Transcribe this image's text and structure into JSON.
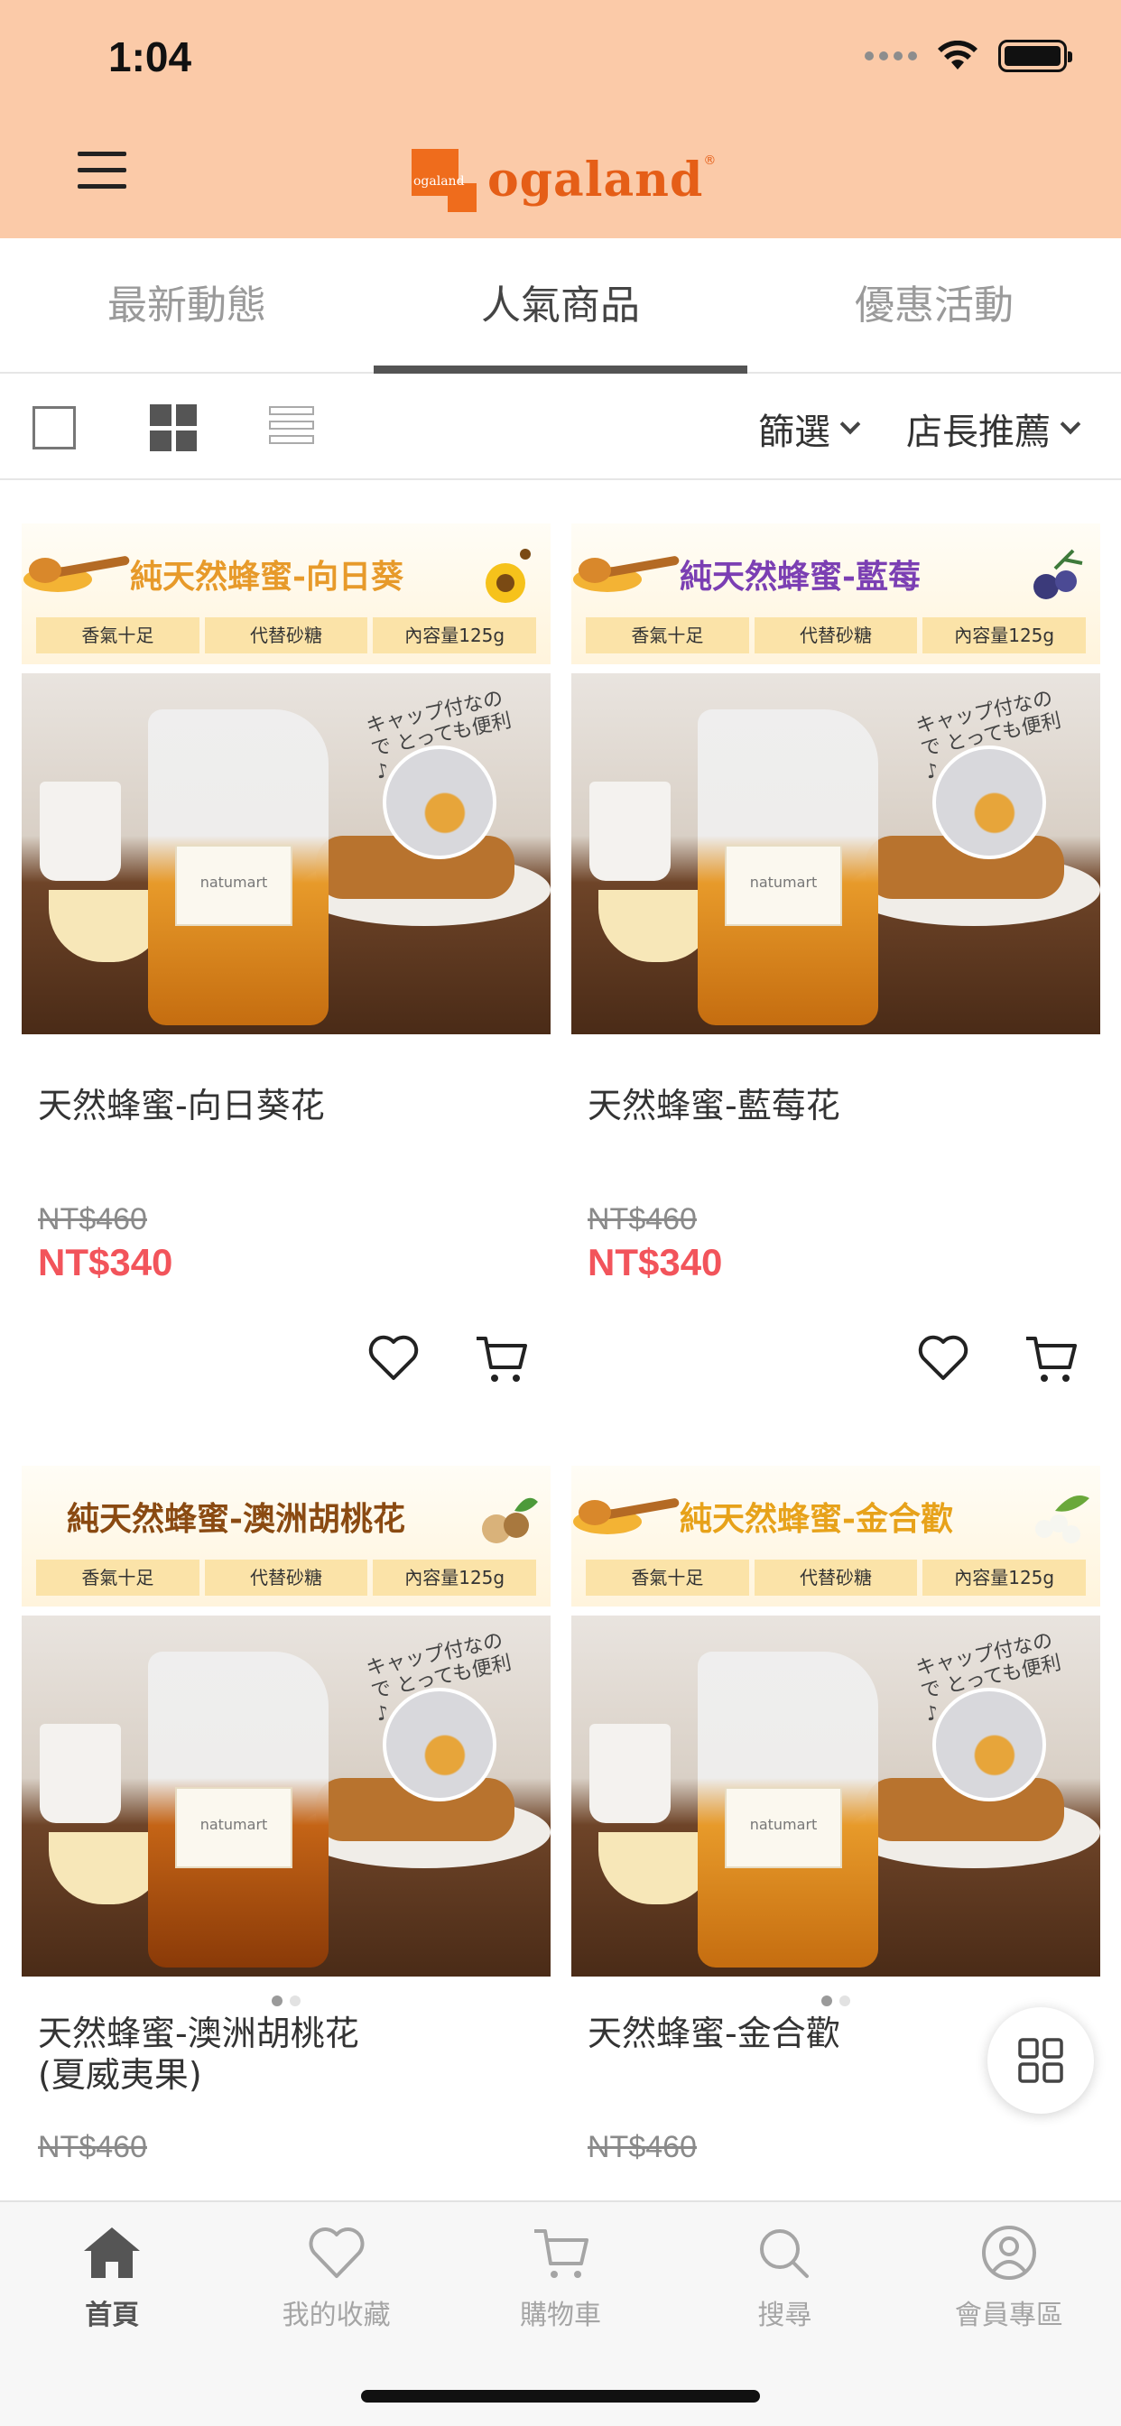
{
  "status_bar": {
    "time": "1:04"
  },
  "header": {
    "brand": "ogaland",
    "brand_mark": "ogaland"
  },
  "tabs": [
    {
      "label": "最新動態",
      "active": false
    },
    {
      "label": "人氣商品",
      "active": true
    },
    {
      "label": "優惠活動",
      "active": false
    }
  ],
  "toolbar": {
    "filter_label": "篩選",
    "sort_label": "店長推薦",
    "view_modes": [
      "single-view-icon",
      "grid-view-icon",
      "list-view-icon"
    ],
    "selected_view": "grid-view-icon"
  },
  "products": [
    {
      "banner_title": "純天然蜂蜜-向日葵",
      "banner_color": "#e79a2a",
      "chips": [
        "香氣十足",
        "代替砂糖",
        "內容量125g"
      ],
      "photo_text": "キャップ付なので とっても便利♪",
      "pouch_label": "natumart",
      "name": "天然蜂蜜-向日葵花",
      "original_price": "NT$460",
      "sale_price": "NT$340"
    },
    {
      "banner_title": "純天然蜂蜜-藍莓",
      "banner_color": "#7b3fb3",
      "chips": [
        "香氣十足",
        "代替砂糖",
        "內容量125g"
      ],
      "photo_text": "キャップ付なので とっても便利♪",
      "pouch_label": "natumart",
      "name": "天然蜂蜜-藍莓花",
      "original_price": "NT$460",
      "sale_price": "NT$340"
    },
    {
      "banner_title": "純天然蜂蜜-澳洲胡桃花",
      "banner_color": "#8a4a12",
      "chips": [
        "香氣十足",
        "代替砂糖",
        "內容量125g"
      ],
      "photo_text": "キャップ付なので とっても便利♪",
      "pouch_label": "natumart",
      "name": "天然蜂蜜-澳洲胡桃花\n(夏威夷果)",
      "original_price": "NT$460"
    },
    {
      "banner_title": "純天然蜂蜜-金合歡",
      "banner_color": "#e7a21a",
      "chips": [
        "香氣十足",
        "代替砂糖",
        "內容量125g"
      ],
      "photo_text": "キャップ付なので とっても便利♪",
      "pouch_label": "natumart",
      "name": "天然蜂蜜-金合歡",
      "original_price": "NT$460"
    }
  ],
  "bottom_nav": [
    {
      "label": "首頁",
      "icon": "home-icon",
      "active": true
    },
    {
      "label": "我的收藏",
      "icon": "heart-icon",
      "active": false
    },
    {
      "label": "購物車",
      "icon": "cart-icon",
      "active": false
    },
    {
      "label": "搜尋",
      "icon": "search-icon",
      "active": false
    },
    {
      "label": "會員專區",
      "icon": "user-icon",
      "active": false
    }
  ],
  "colors": {
    "header_bg": "#fbcaa8",
    "brand": "#e55e17",
    "sale_price": "#f2545b"
  }
}
